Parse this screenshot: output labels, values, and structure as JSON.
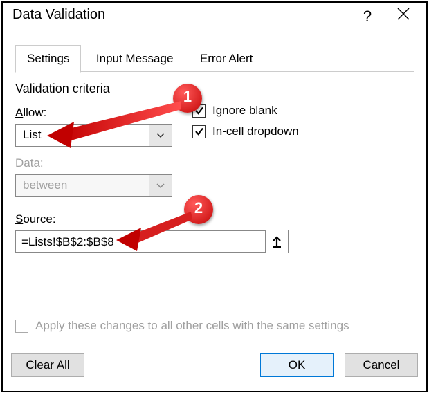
{
  "title": "Data Validation",
  "help_symbol": "?",
  "tabs": {
    "settings": "Settings",
    "input": "Input Message",
    "error": "Error Alert"
  },
  "section": "Validation criteria",
  "allow": {
    "label_pre": "A",
    "label_post": "llow:",
    "value": "List"
  },
  "data": {
    "label_pre": "D",
    "label_post": "ata:",
    "value": "between"
  },
  "source": {
    "label_pre": "S",
    "label_post": "ource:",
    "value": "=Lists!$B$2:$B$8"
  },
  "ignore_blank": {
    "pre": "Ignore ",
    "u": "b",
    "post": "lank"
  },
  "incell": {
    "u": "I",
    "post": "n-cell dropdown"
  },
  "apply": {
    "u": "P",
    "rest": " Apply these changes to all other cells with the same settings",
    "pre": "A",
    "mid": "pply these changes to all other cells with the same settings"
  },
  "buttons": {
    "clear_u": "C",
    "clear_rest": "lear All",
    "ok": "OK",
    "cancel": "Cancel"
  },
  "anno": {
    "one": "1",
    "two": "2"
  }
}
